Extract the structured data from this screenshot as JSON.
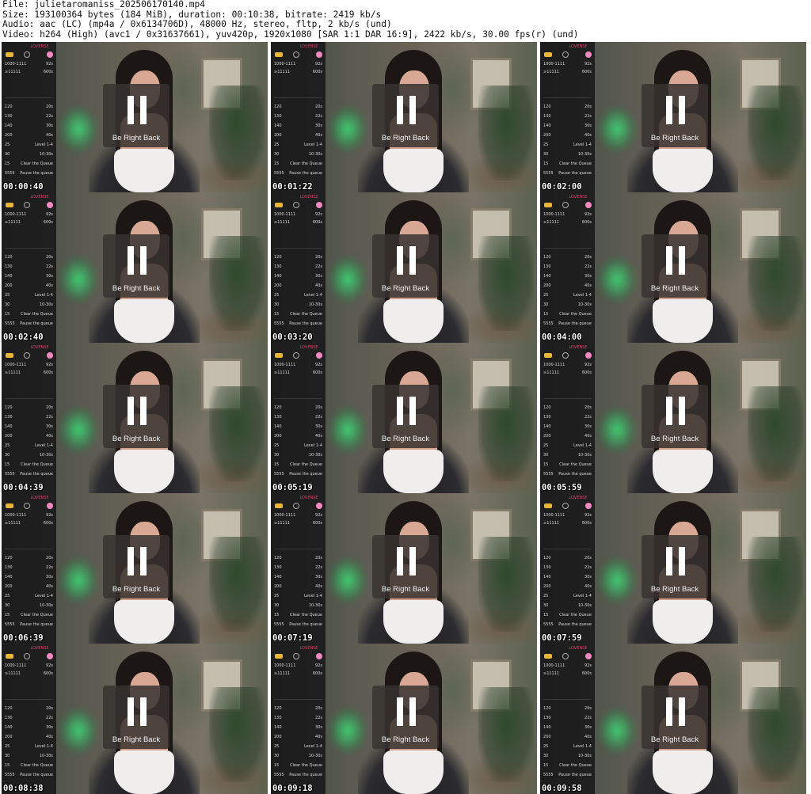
{
  "header": {
    "file_line": "File: julietaromaniss_202506170140.mp4",
    "size_line": "Size: 193100364 bytes (184 MiB), duration: 00:10:38, bitrate: 2419 kb/s",
    "audio_line": "Audio: aac (LC) (mp4a / 0x6134706D), 48000 Hz, stereo, fltp, 2 kb/s (und)",
    "video_line": "Video: h264 (High) (avc1 / 0x31637661), yuv420p, 1920x1080 [SAR 1:1 DAR 16:9], 2422 kb/s, 30.00 fps(r) (und)"
  },
  "overlay": {
    "brb_label": "Be Right Back",
    "pause_icon": "pause-icon"
  },
  "panel": {
    "brand": "LOVENSE",
    "rows": [
      {
        "a": "1000-1111",
        "b": "92s"
      },
      {
        "a": "≥11111",
        "b": "600s"
      },
      {
        "a": "120",
        "b": "20s"
      },
      {
        "a": "130",
        "b": "22s"
      },
      {
        "a": "140",
        "b": "30s"
      },
      {
        "a": "200",
        "b": "40s"
      },
      {
        "a": "25",
        "b": "Level 1-4"
      },
      {
        "a": "30",
        "b": "10-30s"
      },
      {
        "a": "15",
        "b": "Clear the Queue"
      },
      {
        "a": "5555",
        "b": "Pause the queue"
      }
    ]
  },
  "thumbnails": [
    {
      "timestamp": "00:00:40"
    },
    {
      "timestamp": "00:01:22"
    },
    {
      "timestamp": "00:02:00"
    },
    {
      "timestamp": "00:02:40"
    },
    {
      "timestamp": "00:03:20"
    },
    {
      "timestamp": "00:04:00"
    },
    {
      "timestamp": "00:04:39"
    },
    {
      "timestamp": "00:05:19"
    },
    {
      "timestamp": "00:05:59"
    },
    {
      "timestamp": "00:06:39"
    },
    {
      "timestamp": "00:07:19"
    },
    {
      "timestamp": "00:07:59"
    },
    {
      "timestamp": "00:08:38"
    },
    {
      "timestamp": "00:09:18"
    },
    {
      "timestamp": "00:09:58"
    }
  ]
}
